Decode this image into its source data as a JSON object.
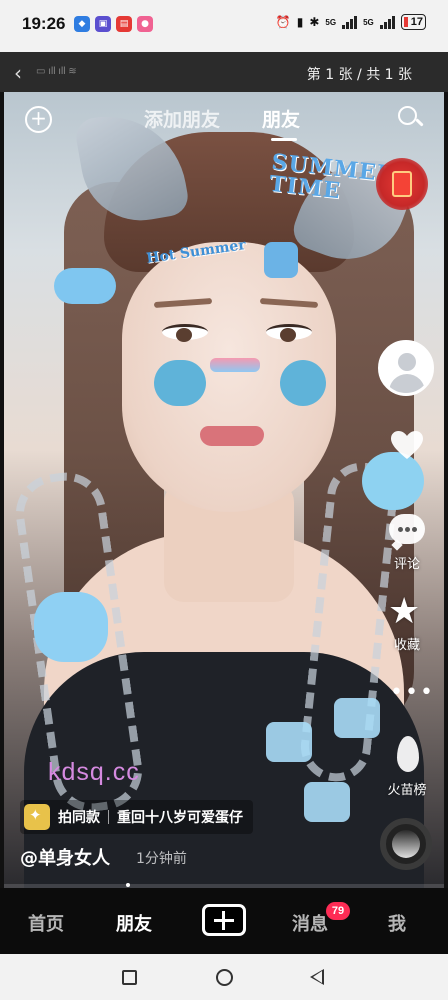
{
  "status_bar": {
    "time": "19:26",
    "apps": [
      "qq-icon",
      "reader-icon",
      "sale-icon",
      "game-icon"
    ],
    "network_5g_a": "5G",
    "network_5g_b": "5G",
    "battery": "17",
    "battery_color": "#e53935"
  },
  "viewer": {
    "pager": "第 1 张 / 共 1 张"
  },
  "top_tabs": {
    "add_friends": "添加朋友",
    "friends": "朋友"
  },
  "stickers": {
    "summer": "SUMMER TIME",
    "hot": "Hot Summer"
  },
  "actions": {
    "comment": "评论",
    "collect": "收藏",
    "hot_list": "火苗榜"
  },
  "watermark": "kdsq.cc",
  "caption": {
    "same_label": "拍同款",
    "song": "重回十八岁可爱蛋仔",
    "author": "@单身女人",
    "time": "1分钟前"
  },
  "bottom_nav": {
    "home": "首页",
    "friends": "朋友",
    "messages": "消息",
    "messages_badge": "79",
    "me": "我"
  },
  "colors": {
    "accent": "#fe2c55",
    "watermark": "#d58ae0",
    "redpacket": "#e53935"
  }
}
